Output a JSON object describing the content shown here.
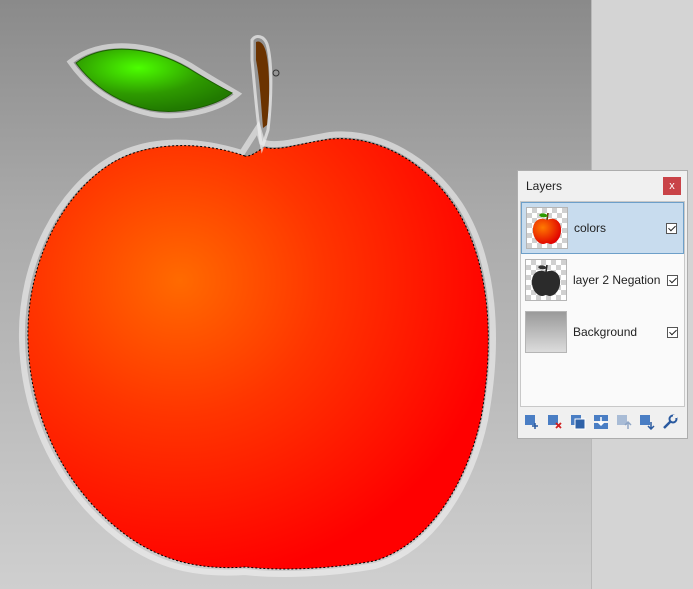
{
  "layers_panel": {
    "title": "Layers",
    "close_glyph": "x",
    "layers": [
      {
        "name": "colors",
        "visible": true,
        "selected": true,
        "thumb": "red-apple"
      },
      {
        "name": "layer 2 Negation",
        "visible": true,
        "selected": false,
        "thumb": "dark-apple"
      },
      {
        "name": "Background",
        "visible": true,
        "selected": false,
        "thumb": "gray-gradient"
      }
    ],
    "toolbar_icons": [
      "add-layer-icon",
      "delete-layer-icon",
      "duplicate-layer-icon",
      "merge-layer-down-icon",
      "move-layer-up-icon",
      "move-layer-down-icon",
      "layer-properties-icon"
    ]
  },
  "canvas": {
    "apple_color": "#ff1a00",
    "apple_highlight": "#ff6a00",
    "leaf_color": "#2e8b00",
    "leaf_highlight": "#4cff00",
    "stem_color": "#6b3300"
  }
}
